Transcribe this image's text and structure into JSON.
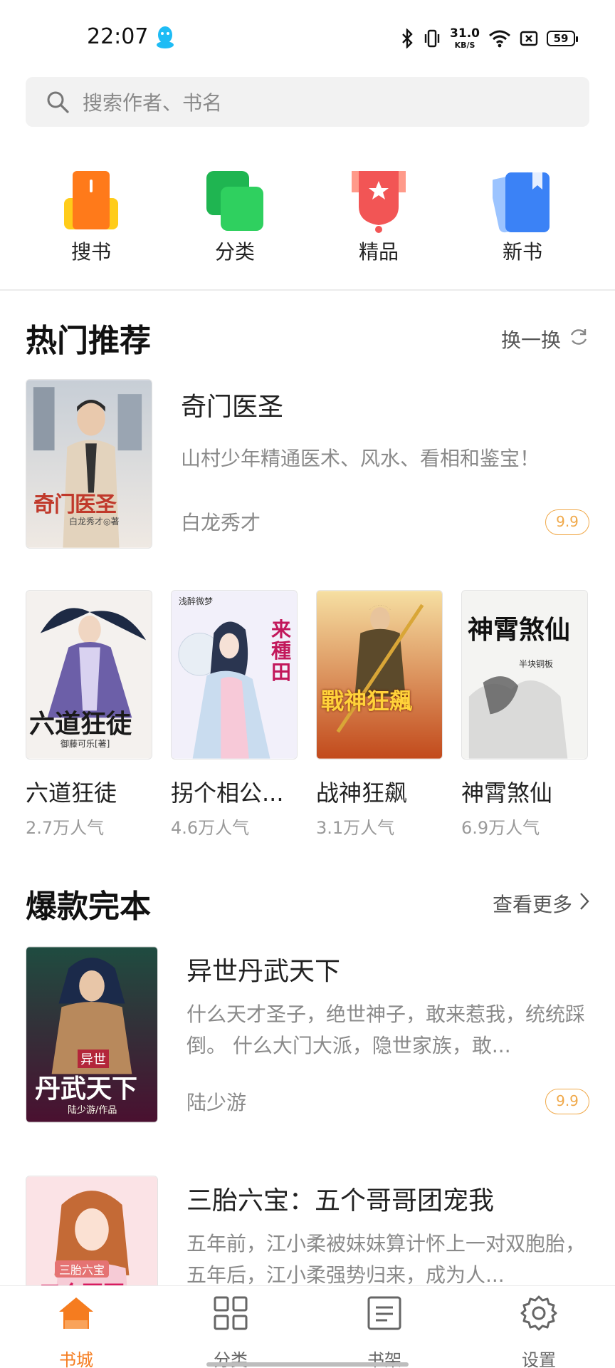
{
  "status_bar": {
    "time": "22:07",
    "net_speed_value": "31.0",
    "net_speed_unit": "KB/S",
    "battery": "59",
    "icons": [
      "qq-icon",
      "bluetooth-icon",
      "vibrate-icon",
      "wifi-icon",
      "sim-off-icon",
      "battery-icon"
    ]
  },
  "search": {
    "placeholder": "搜索作者、书名",
    "icon": "search-icon"
  },
  "quick_entries": [
    {
      "label": "搜书",
      "icon": "search-book-icon",
      "color": "#ff7a1a"
    },
    {
      "label": "分类",
      "icon": "category-icon",
      "color": "#22c55e"
    },
    {
      "label": "精品",
      "icon": "premium-icon",
      "color": "#f25555"
    },
    {
      "label": "新书",
      "icon": "new-book-icon",
      "color": "#3b82f6"
    }
  ],
  "hot": {
    "title": "热门推荐",
    "action": "换一换",
    "featured": {
      "title": "奇门医圣",
      "desc": "山村少年精通医术、风水、看相和鉴宝！",
      "author": "白龙秀才",
      "score": "9.9",
      "cover_title": "奇门医圣",
      "cover_author": "白龙秀才◎著"
    },
    "grid": [
      {
        "title": "六道狂徒",
        "pop": "2.7万人气",
        "cover_title": "六道狂徒",
        "cover_author": "御藤可乐[著]"
      },
      {
        "title": "拐个相公...",
        "pop": "4.6万人气",
        "cover_title": "来種田",
        "cover_author": "浅醉微梦"
      },
      {
        "title": "战神狂飙",
        "pop": "3.1万人气",
        "cover_title": "戰神狂飆",
        "cover_author": ""
      },
      {
        "title": "神霄煞仙",
        "pop": "6.9万人气",
        "cover_title": "神霄煞仙",
        "cover_author": "半块铜板"
      }
    ]
  },
  "complete": {
    "title": "爆款完本",
    "action": "查看更多",
    "books": [
      {
        "title": "异世丹武天下",
        "desc": "什么天才圣子，绝世神子，敢来惹我，统统踩倒。 什么大门大派，隐世家族，敢...",
        "author": "陆少游",
        "score": "9.9",
        "cover_title": "丹武天下",
        "cover_sub": "异世",
        "cover_author": "陆少游/作品"
      },
      {
        "title": "三胎六宝：五个哥哥团宠我",
        "desc": "五年前，江小柔被妹妹算计怀上一对双胞胎，五年后，江小柔强势归来，成为人...",
        "cover_title": "三胎六宝",
        "cover_sub": "五个哥哥"
      }
    ]
  },
  "bottom_nav": [
    {
      "label": "书城",
      "icon": "home-icon",
      "active": true
    },
    {
      "label": "分类",
      "icon": "grid-icon",
      "active": false
    },
    {
      "label": "书架",
      "icon": "bookshelf-icon",
      "active": false
    },
    {
      "label": "设置",
      "icon": "gear-icon",
      "active": false
    }
  ],
  "colors": {
    "accent": "#f57c1f",
    "score": "#f0a94a",
    "muted": "#8a8a8a"
  }
}
